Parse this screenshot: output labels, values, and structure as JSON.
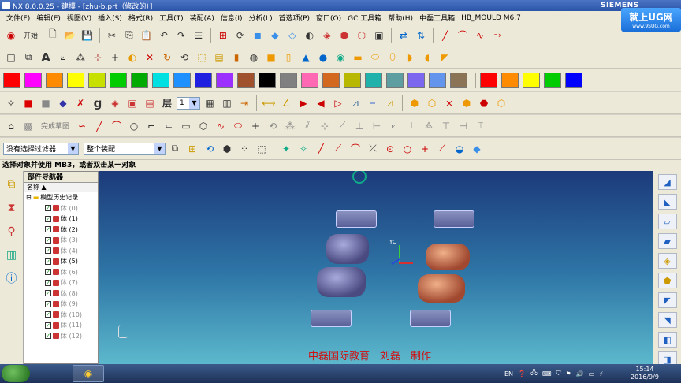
{
  "window": {
    "title": "NX 8.0.0.25 - 建模 - [zhu-b.prt（修改的）]",
    "brand": "SIEMENS"
  },
  "badge": {
    "title": "就上UG网",
    "url": "www.9SUG.com"
  },
  "menu": [
    "文件(F)",
    "编辑(E)",
    "视图(V)",
    "插入(S)",
    "格式(R)",
    "工具(T)",
    "装配(A)",
    "信息(I)",
    "分析(L)",
    "首选项(P)",
    "窗口(O)",
    "GC 工具箱",
    "帮助(H)",
    "中磊工具箱",
    "HB_MOULD M6.7"
  ],
  "toolbar1": {
    "start_label": "开始·"
  },
  "palette_row1": [
    "#ff0000",
    "#ff00ff",
    "#ff8c00",
    "#ffff00",
    "#c8e000",
    "#00cc00",
    "#00aa00",
    "#00e0e0",
    "#1e90ff",
    "#2020e0",
    "#9b30ff",
    "#a0522d",
    "#000000",
    "#808080",
    "#ff69b4",
    "#d2691e",
    "#b8b800",
    "#20b2aa",
    "#5f9ea0",
    "#7b68ee",
    "#6495ed",
    "#8b7355"
  ],
  "palette_row2": [
    "#ff0000",
    "#ff8c00",
    "#ffff00",
    "#00cc00",
    "#0000ff"
  ],
  "toolbar4": {
    "layer_value": "1",
    "layer_glyph": "层"
  },
  "toolbar5": {
    "finish_sketch": "完成草图"
  },
  "selection": {
    "filter": "没有选择过滤器",
    "scope": "整个装配"
  },
  "cue_line": "选择对象并使用 MB3，或者双击某一对象",
  "navigator": {
    "title": "部件导航器",
    "column": "名称",
    "root": "模型历史记录",
    "items": [
      {
        "label": "体 (0)",
        "active": false
      },
      {
        "label": "体 (1)",
        "active": true
      },
      {
        "label": "体 (2)",
        "active": true
      },
      {
        "label": "体 (3)",
        "active": false
      },
      {
        "label": "体 (4)",
        "active": false
      },
      {
        "label": "体 (5)",
        "active": true
      },
      {
        "label": "体 (6)",
        "active": false
      },
      {
        "label": "体 (7)",
        "active": false
      },
      {
        "label": "体 (8)",
        "active": false
      },
      {
        "label": "体 (9)",
        "active": false
      },
      {
        "label": "体 (10)",
        "active": false
      },
      {
        "label": "体 (11)",
        "active": false
      },
      {
        "label": "体 (12)",
        "active": false
      }
    ]
  },
  "viewport": {
    "axis_label": "YC",
    "credit": "中磊国际教育　刘磊　制作"
  },
  "taskbar": {
    "lang": "EN",
    "time": "15:14",
    "date": "2016/9/9"
  }
}
